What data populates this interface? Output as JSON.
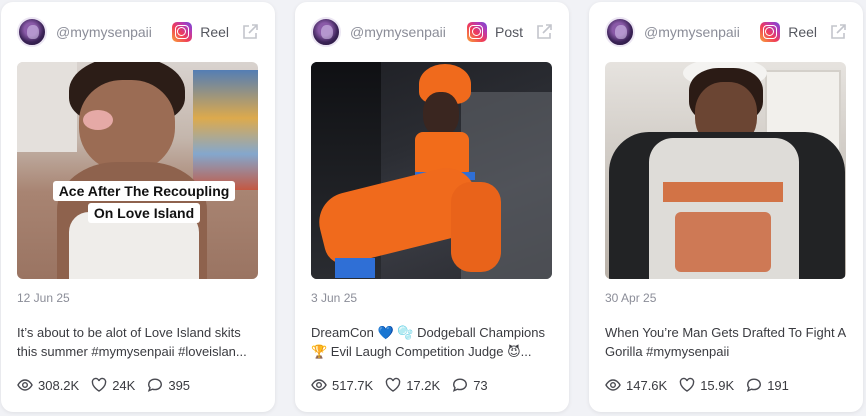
{
  "posts": [
    {
      "handle": "@mymysenpaii",
      "type": "Reel",
      "media_caption": [
        "Ace After The Recoupling",
        "On Love Island"
      ],
      "date": "12 Jun 25",
      "description": "It’s about to be alot of Love Island skits this summer #mymysenpaii #loveislan...",
      "views": "308.2K",
      "likes": "24K",
      "comments": "395"
    },
    {
      "handle": "@mymysenpaii",
      "type": "Post",
      "date": "3 Jun 25",
      "description": "DreamCon 💙 🫧 Dodgeball Champions 🏆 Evil Laugh Competition Judge 😈...",
      "views": "517.7K",
      "likes": "17.2K",
      "comments": "73"
    },
    {
      "handle": "@mymysenpaii",
      "type": "Reel",
      "date": "30 Apr 25",
      "description": "When You’re Man Gets Drafted To Fight A Gorilla #mymysenpaii",
      "views": "147.6K",
      "likes": "15.9K",
      "comments": "191"
    }
  ],
  "icons": {
    "platform": "instagram-icon",
    "external": "external-link-icon",
    "views": "eye-icon",
    "likes": "heart-icon",
    "comments": "comment-icon"
  },
  "colors": {
    "page_bg": "#f1f2f6",
    "card_bg": "#ffffff",
    "muted_text": "#8b8d98",
    "body_text": "#3a3b40"
  }
}
